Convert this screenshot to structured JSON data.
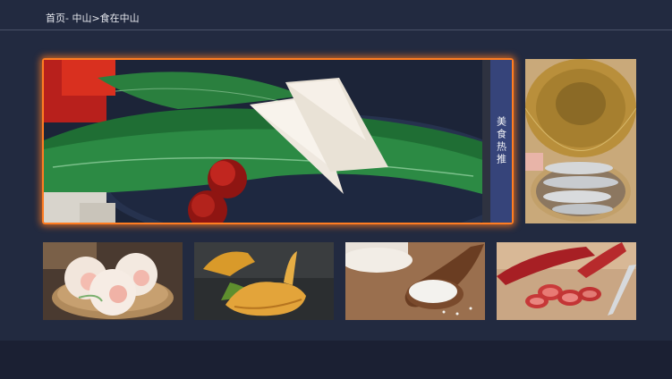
{
  "breadcrumb": "首页- 中山>食在中山",
  "featured": {
    "tab_label": "美食热推"
  },
  "colors": {
    "background": "#222a40",
    "focus_border": "#ff7d22",
    "tab_background": "#36447a",
    "bottom_bar": "#1b2033"
  }
}
